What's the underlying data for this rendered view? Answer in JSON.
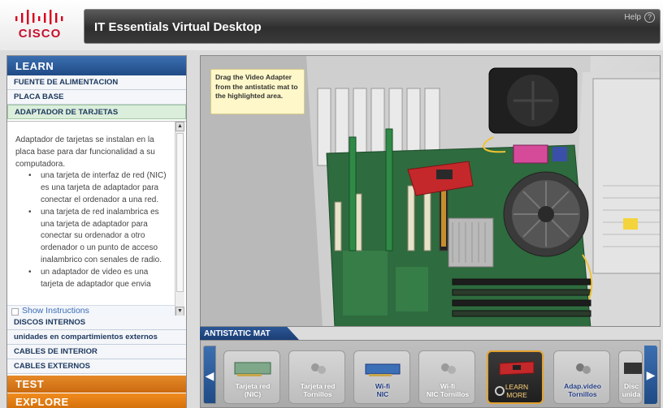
{
  "header": {
    "logo_text": "CISCO",
    "title": "IT Essentials Virtual Desktop",
    "help_label": "Help",
    "help_icon": "?"
  },
  "sidebar": {
    "learn_label": "LEARN",
    "items_top": [
      {
        "label": "FUENTE DE ALIMENTACION"
      },
      {
        "label": "PLACA BASE"
      },
      {
        "label": "ADAPTADOR DE TARJETAS",
        "active": true
      }
    ],
    "content": {
      "intro": "Adaptador de tarjetas se instalan en la placa base para dar funcionalidad a su computadora.",
      "bullets": [
        "una tarjeta de interfaz de red (NIC) es una tarjeta de adaptador para conectar el ordenador a una red.",
        "una tarjeta de red inalambrica es una tarjeta de adaptador para conectar su ordenador a otro ordenador o un punto de acceso inalambrico con senales de radio.",
        "un adaptador de video es una tarjeta de adaptador que envia"
      ],
      "show_instructions": "Show Instructions"
    },
    "items_bottom": [
      {
        "label": "DISCOS INTERNOS"
      },
      {
        "label": "unidades en compartimientos externos"
      },
      {
        "label": "CABLES DE INTERIOR"
      },
      {
        "label": "CABLES EXTERNOS"
      }
    ],
    "test_label": "TEST",
    "explore_label": "EXPLORE"
  },
  "scene": {
    "tooltip": "Drag the Video Adapter from the antistatic mat to the highlighted area."
  },
  "mat": {
    "label": "ANTISTATIC MAT",
    "items": [
      {
        "label_line1": "Tarjeta red",
        "label_line2": "(NIC)",
        "icon": "nic-card-icon"
      },
      {
        "label_line1": "Tarjeta red",
        "label_line2": "Tornillos",
        "icon": "screws-icon"
      },
      {
        "label_line1": "Wi-fi",
        "label_line2": "NIC",
        "icon": "wifi-card-icon"
      },
      {
        "label_line1": "Wi-fi",
        "label_line2": "NIC Tornillos",
        "icon": "screws-icon"
      },
      {
        "label_line1": "LEARN",
        "label_line2": "MORE",
        "icon": "video-card-icon"
      },
      {
        "label_line1": "Adap.video",
        "label_line2": "Tornillos",
        "icon": "screws-icon"
      },
      {
        "label_line1": "Disc",
        "label_line2": "unida",
        "icon": "drive-icon"
      }
    ]
  },
  "colors": {
    "learn_blue": "#1f4b86",
    "test_orange": "#c96a0e",
    "cisco_red": "#c8102e",
    "highlight_gold": "#e3a22e"
  }
}
